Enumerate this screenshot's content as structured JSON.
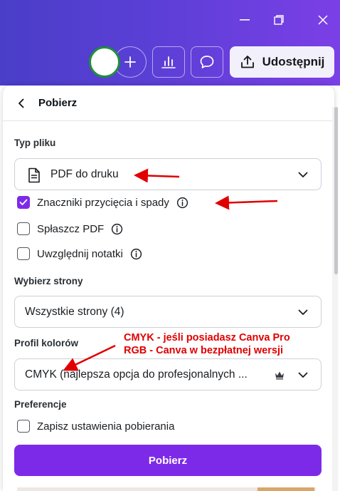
{
  "header": {
    "share_label": "Udostępnij"
  },
  "panel": {
    "title": "Pobierz",
    "file_type": {
      "label": "Typ pliku",
      "value": "PDF do druku"
    },
    "options": [
      {
        "label": "Znaczniki przycięcia i spady",
        "checked": true,
        "info": true
      },
      {
        "label": "Spłaszcz PDF",
        "checked": false,
        "info": true
      },
      {
        "label": "Uwzględnij notatki",
        "checked": false,
        "info": true
      }
    ],
    "pages": {
      "label": "Wybierz strony",
      "value": "Wszystkie strony (4)"
    },
    "color_profile": {
      "label": "Profil kolorów",
      "value": "CMYK (najlepsza opcja do profesjonalnych ..."
    },
    "preferences": {
      "label": "Preferencje",
      "save_settings": "Zapisz ustawienia pobierania",
      "checked": false
    },
    "download_label": "Pobierz"
  },
  "annotations": {
    "line1": "CMYK - jeśli posiadasz Canva Pro",
    "line2": "RGB - Canva w bezpłatnej wersji",
    "color": "#e00000"
  },
  "colors": {
    "accent": "#7d2ae8",
    "toolbar_start": "#4a3ec8",
    "toolbar_end": "#7b3fe6"
  }
}
